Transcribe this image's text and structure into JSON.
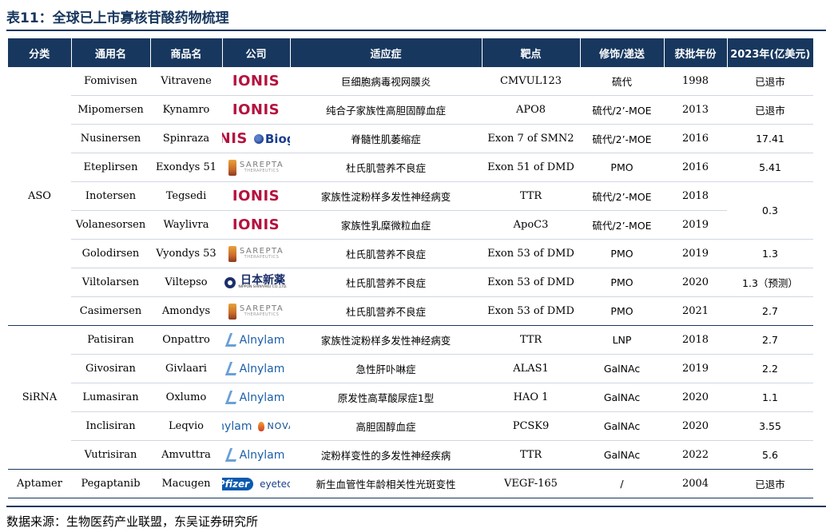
{
  "title": "表11：全球已上市寡核苷酸药物梳理",
  "source": "数据来源：生物医药产业联盟，东吴证券研究所",
  "headers": [
    "分类",
    "通用名",
    "商品名",
    "公司",
    "适应症",
    "靶点",
    "修饰/递送",
    "获批年份",
    "2023年(亿美元)"
  ],
  "groups": [
    {
      "name": "ASO",
      "rows": 9
    },
    {
      "name": "SiRNA",
      "rows": 5
    },
    {
      "name": "Aptamer",
      "rows": 1
    }
  ],
  "logo_text": {
    "ionis": "IONIS",
    "biogen": "Biogen",
    "sarepta": "SAREPTA",
    "sarepta_sub": "THERAPEUTICS",
    "alnylam": "Alnylam",
    "novartis": "NOVARTIS",
    "nippon": "日本新薬",
    "nippon_sub": "NIPPON SHINYAKU CO.,LTD.",
    "pfizer": "Pfizer",
    "eyetech": "eyetech"
  },
  "brand_colors": {
    "header": "#17375e",
    "ionis": "#b5123e",
    "alnylam": "#1b5ea8",
    "biogen": "#1b3f8f"
  },
  "rows": [
    {
      "generic": "Fomivisen",
      "brand": "Vitravene",
      "company": "ionis",
      "indication": "巨细胞病毒视网膜炎",
      "target": "CMVUL123",
      "mod": "硫代",
      "year": "1998",
      "sales": "已退市"
    },
    {
      "generic": "Mipomersen",
      "brand": "Kynamro",
      "company": "ionis",
      "indication": "纯合子家族性高胆固醇血症",
      "target": "APO8",
      "mod": "硫代/2’-MOE",
      "year": "2013",
      "sales": "已退市"
    },
    {
      "generic": "Nusinersen",
      "brand": "Spinraza",
      "company": "ionis+biogen",
      "indication": "脊髓性肌萎缩症",
      "target": "Exon 7 of SMN2",
      "mod": "硫代/2’-MOE",
      "year": "2016",
      "sales": "17.41"
    },
    {
      "generic": "Eteplirsen",
      "brand": "Exondys 51",
      "company": "sarepta",
      "indication": "杜氏肌营养不良症",
      "target": "Exon 51 of DMD",
      "mod": "PMO",
      "year": "2016",
      "sales": "5.41"
    },
    {
      "generic": "Inotersen",
      "brand": "Tegsedi",
      "company": "ionis",
      "indication": "家族性淀粉样多发性神经病变",
      "target": "TTR",
      "mod": "硫代/2’-MOE",
      "year": "2018",
      "sales": "0.3",
      "sales_rowspan": 2
    },
    {
      "generic": "Volanesorsen",
      "brand": "Waylivra",
      "company": "ionis",
      "indication": "家族性乳糜微粒血症",
      "target": "ApoC3",
      "mod": "硫代/2’-MOE",
      "year": "2019",
      "sales": null
    },
    {
      "generic": "Golodirsen",
      "brand": "Vyondys 53",
      "company": "sarepta",
      "indication": "杜氏肌营养不良症",
      "target": "Exon 53 of DMD",
      "mod": "PMO",
      "year": "2019",
      "sales": "1.3"
    },
    {
      "generic": "Viltolarsen",
      "brand": "Viltepso",
      "company": "nippon",
      "indication": "杜氏肌营养不良症",
      "target": "Exon 53 of DMD",
      "mod": "PMO",
      "year": "2020",
      "sales": "1.3（预测）"
    },
    {
      "generic": "Casimersen",
      "brand": "Amondys",
      "company": "sarepta",
      "indication": "杜氏肌营养不良症",
      "target": "Exon 53 of DMD",
      "mod": "PMO",
      "year": "2021",
      "sales": "2.7"
    },
    {
      "generic": "Patisiran",
      "brand": "Onpattro",
      "company": "alnylam",
      "indication": "家族性淀粉样多发性神经病变",
      "target": "TTR",
      "mod": "LNP",
      "year": "2018",
      "sales": "2.7"
    },
    {
      "generic": "Givosiran",
      "brand": "Givlaari",
      "company": "alnylam",
      "indication": "急性肝卟啉症",
      "target": "ALAS1",
      "mod": "GalNAc",
      "year": "2019",
      "sales": "2.2"
    },
    {
      "generic": "Lumasiran",
      "brand": "Oxlumo",
      "company": "alnylam",
      "indication": "原发性高草酸尿症1型",
      "target": "HAO 1",
      "mod": "GalNAc",
      "year": "2020",
      "sales": "1.1"
    },
    {
      "generic": "Inclisiran",
      "brand": "Leqvio",
      "company": "alnylam+novartis",
      "indication": "高胆固醇血症",
      "target": "PCSK9",
      "mod": "GalNAc",
      "year": "2020",
      "sales": "3.55"
    },
    {
      "generic": "Vutrisiran",
      "brand": "Amvuttra",
      "company": "alnylam",
      "indication": "淀粉样变性的多发性神经疾病",
      "target": "TTR",
      "mod": "GalNAc",
      "year": "2022",
      "sales": "5.6"
    },
    {
      "generic": "Pegaptanib",
      "brand": "Macugen",
      "company": "pfizer+eyetech",
      "indication": "新生血管性年龄相关性光斑变性",
      "target": "VEGF-165",
      "mod": "/",
      "year": "2004",
      "sales": "已退市"
    }
  ]
}
